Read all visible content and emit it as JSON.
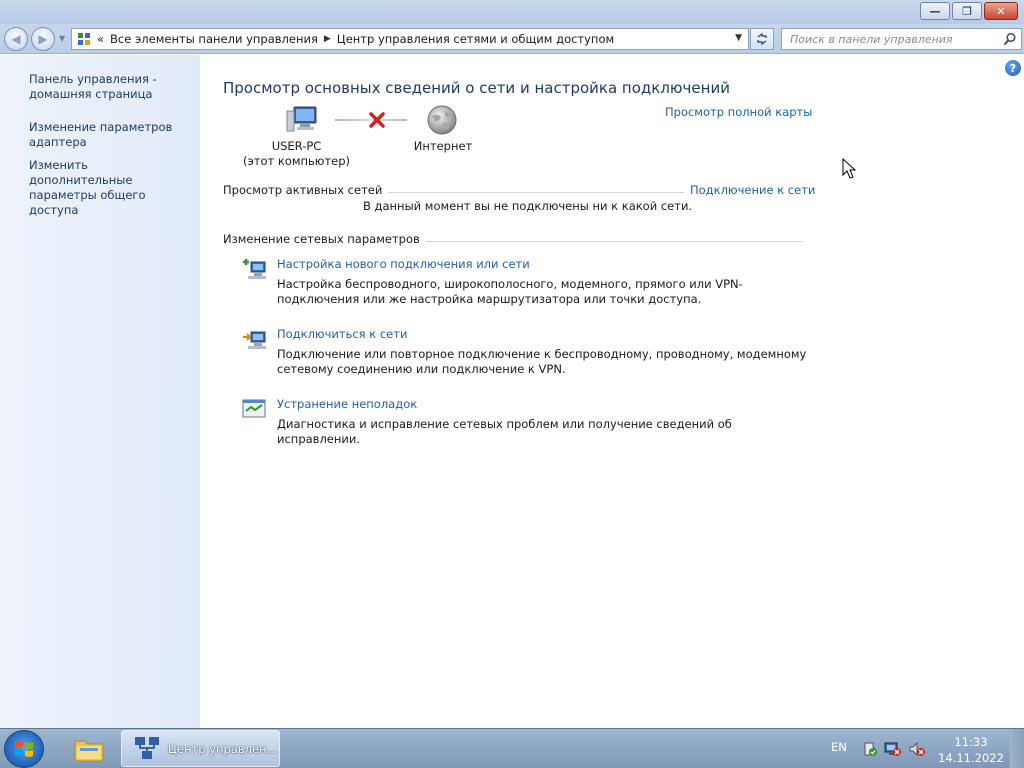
{
  "window": {
    "minimize_label": "—",
    "maximize_label": "❐",
    "close_label": "✕"
  },
  "nav": {
    "back_glyph": "◀",
    "forward_glyph": "▶",
    "breadcrumb_chevron": "«",
    "breadcrumbs": [
      "Все элементы панели управления",
      "Центр управления сетями и общим доступом"
    ],
    "crumb_separator": "▶",
    "search_placeholder": "Поиск в панели управления"
  },
  "sidebar": {
    "items": [
      {
        "label": "Панель управления - домашняя страница"
      },
      {
        "label": "Изменение параметров адаптера"
      },
      {
        "label": "Изменить дополнительные параметры общего доступа"
      }
    ]
  },
  "main": {
    "heading": "Просмотр основных сведений о сети и настройка подключений",
    "full_map_link": "Просмотр полной карты",
    "pc_name": "USER-PC",
    "pc_subtitle": "(этот компьютер)",
    "internet_label": "Интернет",
    "active_networks_title": "Просмотр активных сетей",
    "connect_link": "Подключение к сети",
    "no_connection_text": "В данный момент вы не подключены ни к какой сети.",
    "change_settings_title": "Изменение сетевых параметров",
    "help_glyph": "?",
    "tasks": [
      {
        "icon": "network-setup-icon",
        "link": "Настройка нового подключения или сети",
        "desc": "Настройка беспроводного, широкополосного, модемного, прямого или VPN-подключения или же настройка маршрутизатора или точки доступа."
      },
      {
        "icon": "connect-network-icon",
        "link": "Подключиться к сети",
        "desc": "Подключение или повторное подключение к беспроводному, проводному, модемному сетевому соединению или подключение к VPN."
      },
      {
        "icon": "troubleshoot-icon",
        "link": "Устранение неполадок",
        "desc": "Диагностика и исправление сетевых проблем или получение сведений об исправлении."
      }
    ]
  },
  "taskbar": {
    "active_window_label": "Центр управлен...",
    "language": "EN",
    "time": "11:33",
    "date": "14.11.2022"
  }
}
